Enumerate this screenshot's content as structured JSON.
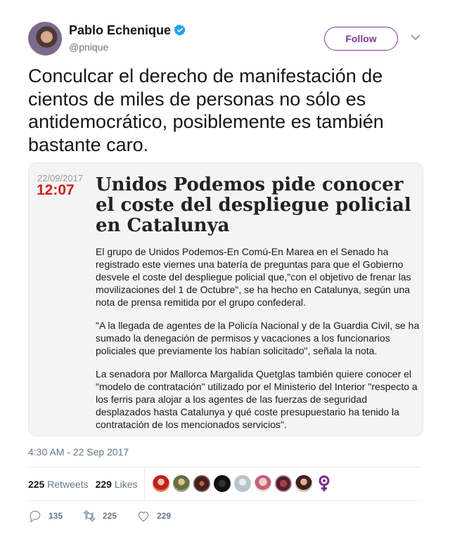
{
  "author": {
    "display_name": "Pablo Echenique",
    "handle": "@pnique",
    "verified": true,
    "avatar_icon": "user-avatar"
  },
  "follow_label": "Follow",
  "tweet_text": "Conculcar el derecho de manifestación de cientos de miles de personas no sólo es antidemocrático, posiblemente es también bastante caro.",
  "media": {
    "date": "22/09/2017",
    "time": "12:07",
    "headline": "Unidos Podemos pide conocer el coste del despliegue policial en Catalunya",
    "paragraphs": [
      "El grupo de Unidos Podemos-En Comú-En Marea en el Senado ha registrado este viernes una batería de preguntas para que el Gobierno desvele el coste del despliegue policial que,\"con el objetivo de frenar las movilizaciones del 1 de Octubre\", se ha hecho en Catalunya, según una nota de prensa remitida por el grupo confederal.",
      "\"A la llegada de agentes de la Policía Nacional y de la Guardia Civil, se ha sumado la denegación de permisos y vacaciones a los funcionarios policiales que previamente los habían solicitado\", señala la nota.",
      "La senadora por Mallorca Margalida Quetglas también quiere conocer el \"modelo de contratación\" utilizado por el Ministerio del Interior \"respecto a los ferris para alojar a los agentes de las fuerzas de seguridad desplazados hasta Catalunya y qué coste presupuestario ha tenido la contratación de los mencionados servicios\"."
    ],
    "time_color": "#d32020"
  },
  "timestamp": "4:30 AM - 22 Sep 2017",
  "stats": {
    "retweets_count": "225",
    "retweets_label": "Retweets",
    "likes_count": "229",
    "likes_label": "Likes"
  },
  "actions": {
    "reply_count": "135",
    "retweet_count": "225",
    "like_count": "229"
  },
  "colors": {
    "accent": "#7b3a9a",
    "secondary_text": "#657786",
    "verified_blue": "#1da1f2"
  }
}
